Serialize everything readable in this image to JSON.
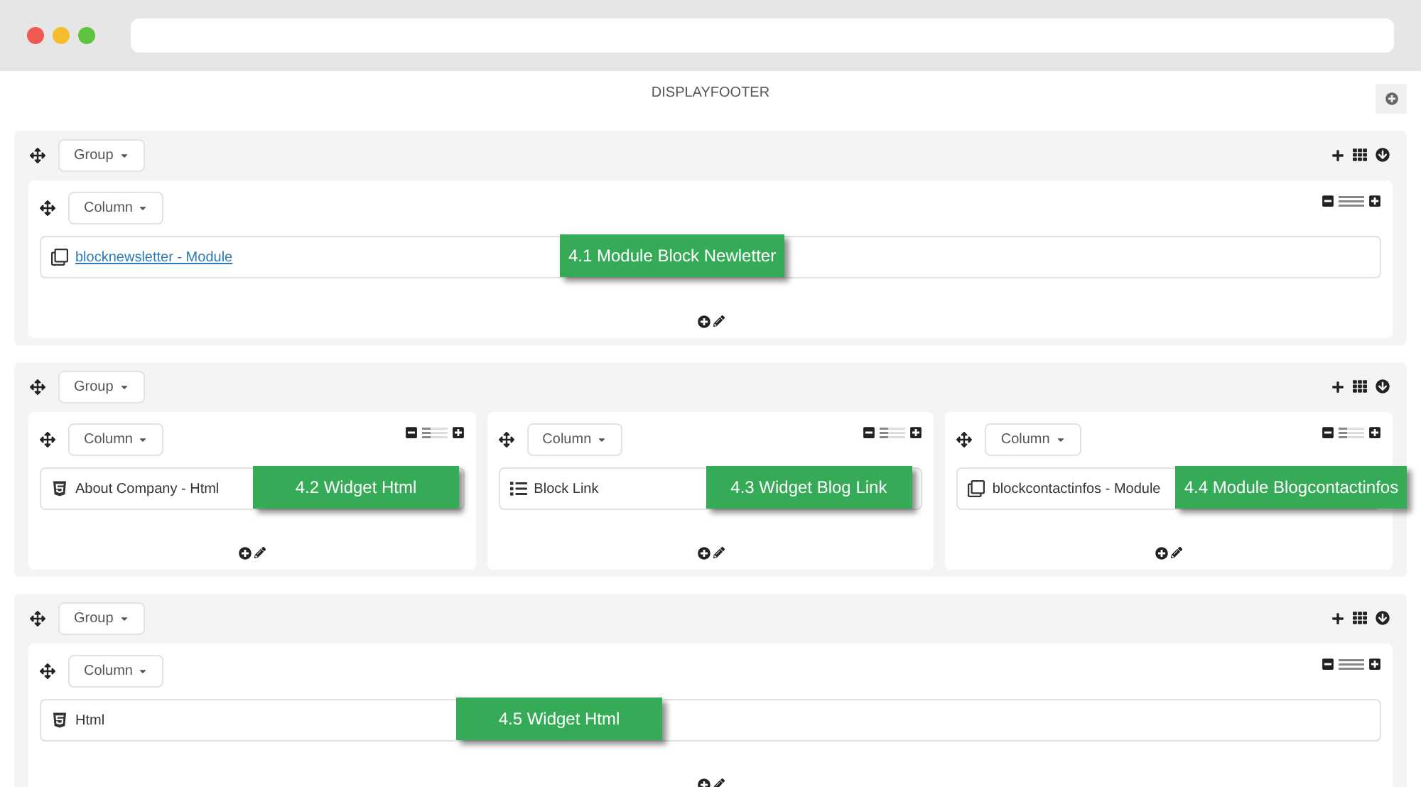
{
  "page": {
    "title": "DISPLAYFOOTER"
  },
  "groups": [
    {
      "label": "Group",
      "columns": [
        {
          "label": "Column",
          "modules": [
            {
              "kind": "module",
              "name": "blocknewsletter - Module",
              "linked": true,
              "callout": "4.1 Module Block Newletter"
            }
          ]
        }
      ]
    },
    {
      "label": "Group",
      "columns": [
        {
          "label": "Column",
          "modules": [
            {
              "kind": "html",
              "name": "About Company - Html",
              "linked": false,
              "callout": "4.2 Widget Html"
            }
          ]
        },
        {
          "label": "Column",
          "modules": [
            {
              "kind": "links",
              "name": "Block Link",
              "linked": false,
              "callout": "4.3 Widget Blog Link"
            }
          ]
        },
        {
          "label": "Column",
          "modules": [
            {
              "kind": "module",
              "name": "blockcontactinfos - Module",
              "linked": false,
              "callout": "4.4 Module Blogcontactinfos"
            }
          ]
        }
      ]
    },
    {
      "label": "Group",
      "columns": [
        {
          "label": "Column",
          "modules": [
            {
              "kind": "html",
              "name": "Html",
              "linked": false,
              "callout": "4.5 Widget Html"
            }
          ]
        }
      ]
    }
  ]
}
